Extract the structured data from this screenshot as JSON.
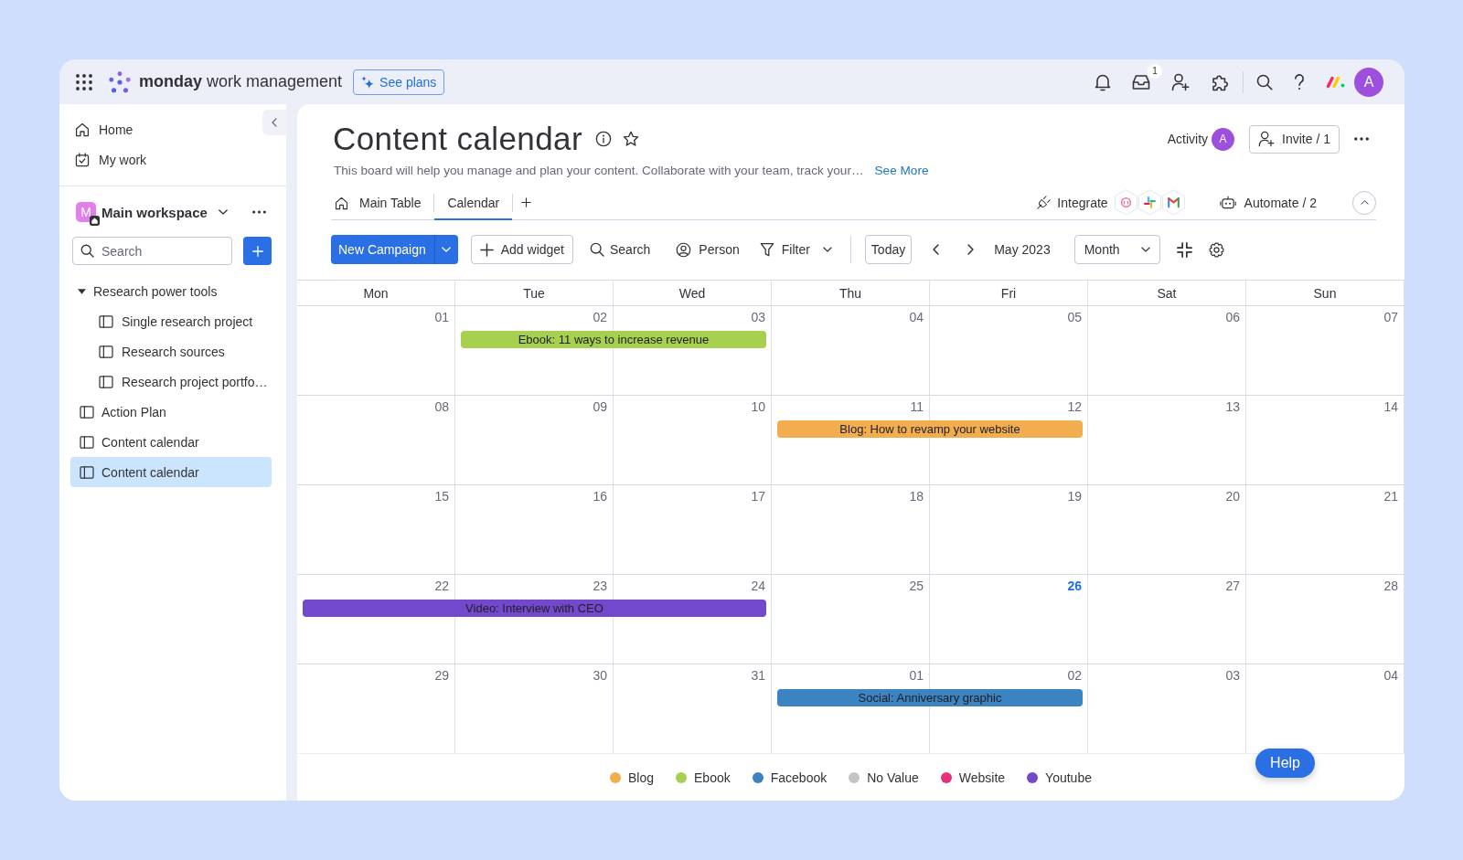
{
  "top_bar": {
    "brand": {
      "name": "monday",
      "product": "work management"
    },
    "plans_button": "See plans",
    "inbox_count": "1",
    "avatar": "A"
  },
  "sidebar": {
    "nav": [
      {
        "label": "Home",
        "kind": "home",
        "selected": false
      },
      {
        "label": "My work",
        "kind": "my-work",
        "selected": false
      }
    ],
    "workspace": {
      "initial": "M",
      "name": "Main workspace"
    },
    "search": {
      "placeholder": "Search"
    },
    "tree": [
      {
        "label": "Research power tools",
        "kind": "folder",
        "expanded": true,
        "selected": false,
        "children": [
          {
            "label": "Single research project",
            "kind": "board",
            "selected": false
          },
          {
            "label": "Research sources",
            "kind": "board",
            "selected": false
          },
          {
            "label": "Research project portfo…",
            "kind": "board",
            "selected": false
          }
        ]
      },
      {
        "label": "Action Plan",
        "kind": "board",
        "selected": false
      },
      {
        "label": "Content calendar",
        "kind": "board",
        "selected": false
      },
      {
        "label": "Content calendar",
        "kind": "board",
        "selected": true
      }
    ]
  },
  "board": {
    "title": "Content calendar",
    "description": "This board will help you manage and plan your content. Collaborate with your team, track your…",
    "see_more": "See More",
    "activity": "Activity",
    "activity_avatar": "A",
    "invite": "Invite / 1",
    "views": [
      {
        "label": "Main Table",
        "kind": "table",
        "selected": false
      },
      {
        "label": "Calendar",
        "kind": "calendar",
        "selected": true
      }
    ],
    "integrate": "Integrate",
    "automate": "Automate / 2"
  },
  "toolbar": {
    "new_item": "New Campaign",
    "add_widget": "Add widget",
    "search": "Search",
    "person": "Person",
    "filter": "Filter",
    "today": "Today",
    "period": "May 2023",
    "view": "Month"
  },
  "calendar": {
    "weekdays": [
      "Mon",
      "Tue",
      "Wed",
      "Thu",
      "Fri",
      "Sat",
      "Sun"
    ],
    "weeks": [
      {
        "days": [
          {
            "label": "01",
            "today": false
          },
          {
            "label": "02",
            "today": false
          },
          {
            "label": "03",
            "today": false
          },
          {
            "label": "04",
            "today": false
          },
          {
            "label": "05",
            "today": false
          },
          {
            "label": "06",
            "today": false
          },
          {
            "label": "07",
            "today": false
          }
        ],
        "events": [
          {
            "title": "Ebook: 11 ways to increase revenue",
            "covers": [
              false,
              true,
              true,
              false,
              false,
              false,
              false
            ],
            "color": "#a6d04d"
          }
        ]
      },
      {
        "days": [
          {
            "label": "08",
            "today": false
          },
          {
            "label": "09",
            "today": false
          },
          {
            "label": "10",
            "today": false
          },
          {
            "label": "11",
            "today": false
          },
          {
            "label": "12",
            "today": false
          },
          {
            "label": "13",
            "today": false
          },
          {
            "label": "14",
            "today": false
          }
        ],
        "events": [
          {
            "title": "Blog: How to revamp your website",
            "covers": [
              false,
              false,
              false,
              true,
              true,
              false,
              false
            ],
            "color": "#f2ad4f"
          }
        ]
      },
      {
        "days": [
          {
            "label": "15",
            "today": false
          },
          {
            "label": "16",
            "today": false
          },
          {
            "label": "17",
            "today": false
          },
          {
            "label": "18",
            "today": false
          },
          {
            "label": "19",
            "today": false
          },
          {
            "label": "20",
            "today": false
          },
          {
            "label": "21",
            "today": false
          }
        ]
      },
      {
        "days": [
          {
            "label": "22",
            "today": false
          },
          {
            "label": "23",
            "today": false
          },
          {
            "label": "24",
            "today": false
          },
          {
            "label": "25",
            "today": false
          },
          {
            "label": "26",
            "today": true
          },
          {
            "label": "27",
            "today": false
          },
          {
            "label": "28",
            "today": false
          }
        ],
        "events": [
          {
            "title": "Video: Interview with CEO",
            "covers": [
              true,
              true,
              true,
              false,
              false,
              false,
              false
            ],
            "color": "#7248cd"
          }
        ]
      },
      {
        "days": [
          {
            "label": "29",
            "today": false
          },
          {
            "label": "30",
            "today": false
          },
          {
            "label": "31",
            "today": false
          },
          {
            "label": "01",
            "today": false
          },
          {
            "label": "02",
            "today": false
          },
          {
            "label": "03",
            "today": false
          },
          {
            "label": "04",
            "today": false
          }
        ],
        "events": [
          {
            "title": "Social: Anniversary graphic",
            "covers": [
              false,
              false,
              false,
              true,
              true,
              false,
              false
            ],
            "color": "#3b83c1"
          }
        ]
      }
    ]
  },
  "legend": [
    {
      "label": "Blog",
      "color": "#f2ad4f"
    },
    {
      "label": "Ebook",
      "color": "#a6d04d"
    },
    {
      "label": "Facebook",
      "color": "#3b83c1"
    },
    {
      "label": "No Value",
      "color": "#c4c4c4"
    },
    {
      "label": "Website",
      "color": "#e6317c"
    },
    {
      "label": "Youtube",
      "color": "#7248cd"
    }
  ],
  "help_button": "Help"
}
